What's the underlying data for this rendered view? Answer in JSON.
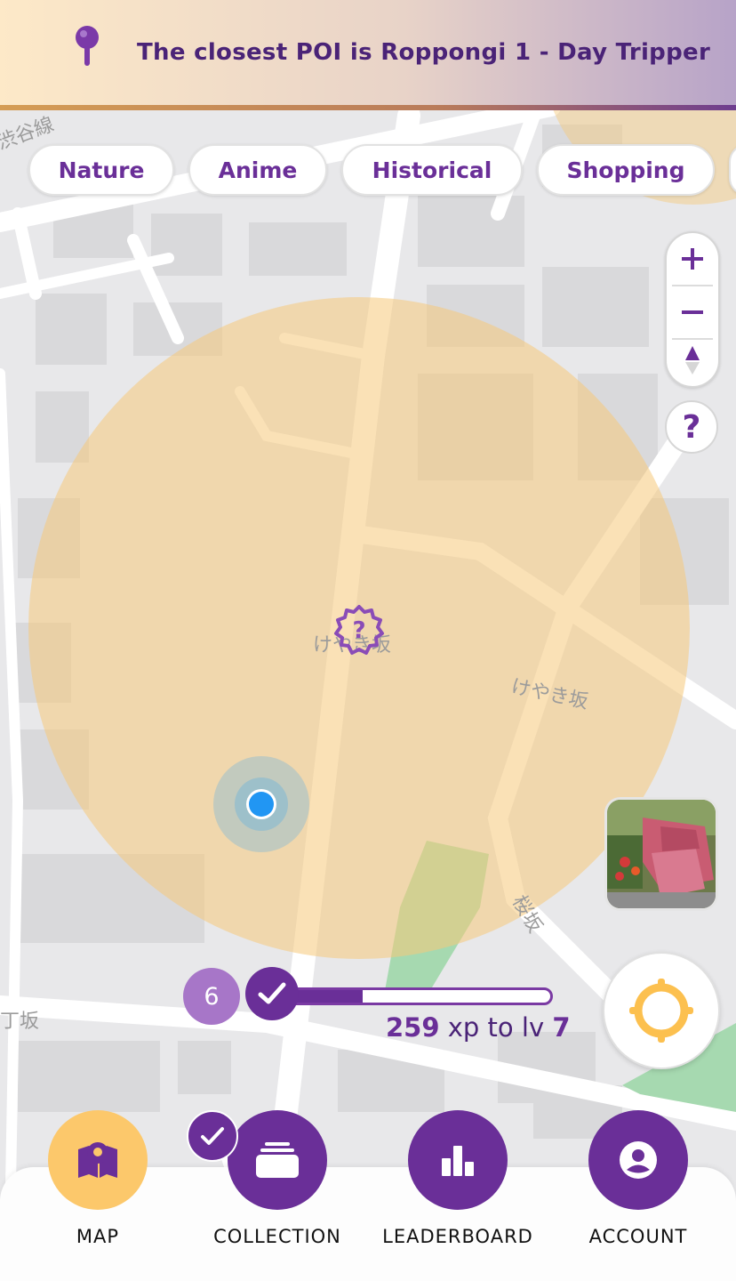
{
  "banner": {
    "text": "The closest POI is Roppongi 1 - Day Tripper",
    "icon": "map-pin-icon"
  },
  "filters": [
    {
      "label": "Nature"
    },
    {
      "label": "Anime"
    },
    {
      "label": "Historical"
    },
    {
      "label": "Shopping"
    }
  ],
  "map": {
    "street_labels": [
      "けやき坂",
      "けやき坂",
      "桜坂",
      "渋谷線",
      "丁坂"
    ],
    "poi_marker_icon": "question-badge-icon",
    "user_location_icon": "blue-dot-icon"
  },
  "controls": {
    "zoom_in": "+",
    "zoom_out": "−",
    "compass": "▲",
    "help": "?"
  },
  "xp": {
    "level": "6",
    "next_level": "7",
    "remaining": "259",
    "mid_text": " xp to lv ",
    "progress": 0.36
  },
  "nav": [
    {
      "label": "MAP",
      "icon": "map-icon",
      "active": true
    },
    {
      "label": "COLLECTION",
      "icon": "collection-icon",
      "active": false
    },
    {
      "label": "LEADERBOARD",
      "icon": "leaderboard-icon",
      "active": false
    },
    {
      "label": "ACCOUNT",
      "icon": "account-icon",
      "active": false
    }
  ],
  "colors": {
    "primary": "#6a2f98",
    "accent": "#fcc86b",
    "radius": "#f6c97a",
    "user": "#2196f3"
  }
}
